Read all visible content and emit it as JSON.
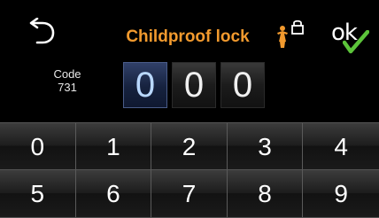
{
  "header": {
    "title": "Childproof lock",
    "back_icon": "back-arrow-icon",
    "lock_icon": "child-lock-icon",
    "ok_label": "ok",
    "ok_check_icon": "checkmark-icon"
  },
  "code": {
    "label": "Code",
    "value": "731"
  },
  "digits": [
    "0",
    "0",
    "0"
  ],
  "active_digit_index": 0,
  "keypad": {
    "keys": [
      "0",
      "1",
      "2",
      "3",
      "4",
      "5",
      "6",
      "7",
      "8",
      "9"
    ]
  },
  "colors": {
    "title": "#f29a2e",
    "check": "#5cc43a",
    "active_digit_bg": "#16223e"
  }
}
